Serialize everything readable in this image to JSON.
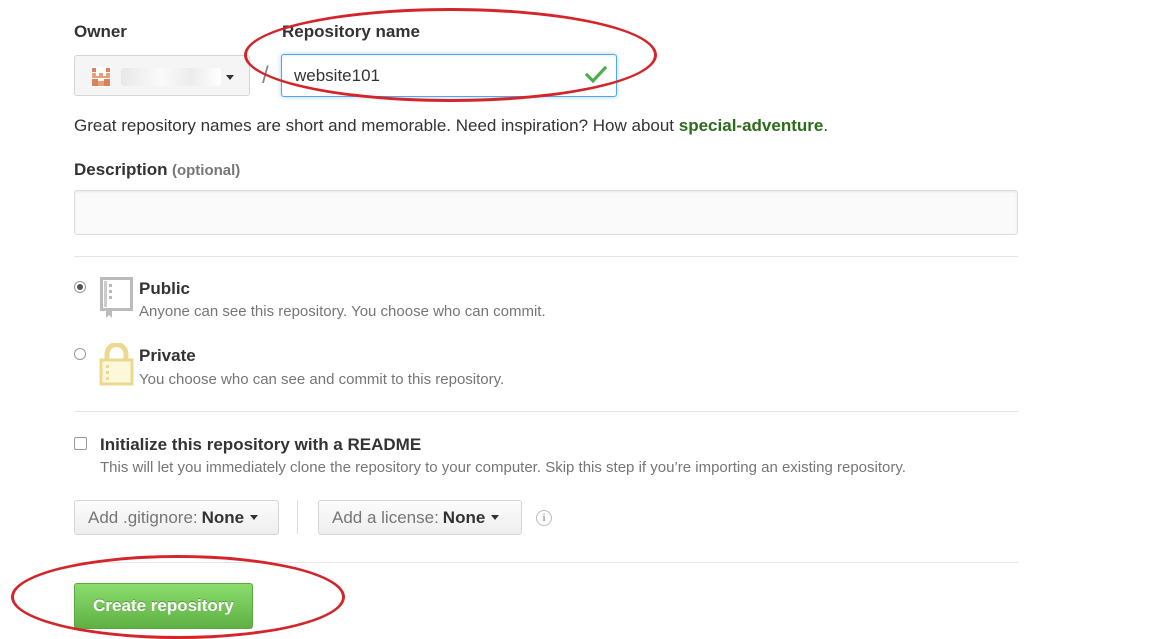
{
  "owner": {
    "label": "Owner",
    "name_redacted": true
  },
  "repo_name": {
    "label": "Repository name",
    "value": "website101",
    "valid": true
  },
  "hint": {
    "prefix": "Great repository names are short and memorable. Need inspiration? How about ",
    "suggestion": "special-adventure",
    "suffix": "."
  },
  "description": {
    "label": "Description",
    "optional": "(optional)",
    "value": ""
  },
  "visibility": {
    "public": {
      "title": "Public",
      "subtitle": "Anyone can see this repository. You choose who can commit.",
      "selected": true,
      "icon": "repo-book-icon"
    },
    "private": {
      "title": "Private",
      "subtitle": "You choose who can see and commit to this repository.",
      "selected": false,
      "icon": "lock-icon"
    }
  },
  "readme": {
    "title": "Initialize this repository with a README",
    "subtitle": "This will let you immediately clone the repository to your computer. Skip this step if you’re importing an existing repository.",
    "checked": false
  },
  "gitignore": {
    "prefix": "Add .gitignore:",
    "value": "None"
  },
  "license": {
    "prefix": "Add a license:",
    "value": "None"
  },
  "create_button": {
    "label": "Create repository"
  },
  "colors": {
    "annotation_red": "#d3252a",
    "suggestion_green": "#2c6c1a",
    "button_green": "#60b044",
    "focus_blue": "#51a7e8"
  }
}
